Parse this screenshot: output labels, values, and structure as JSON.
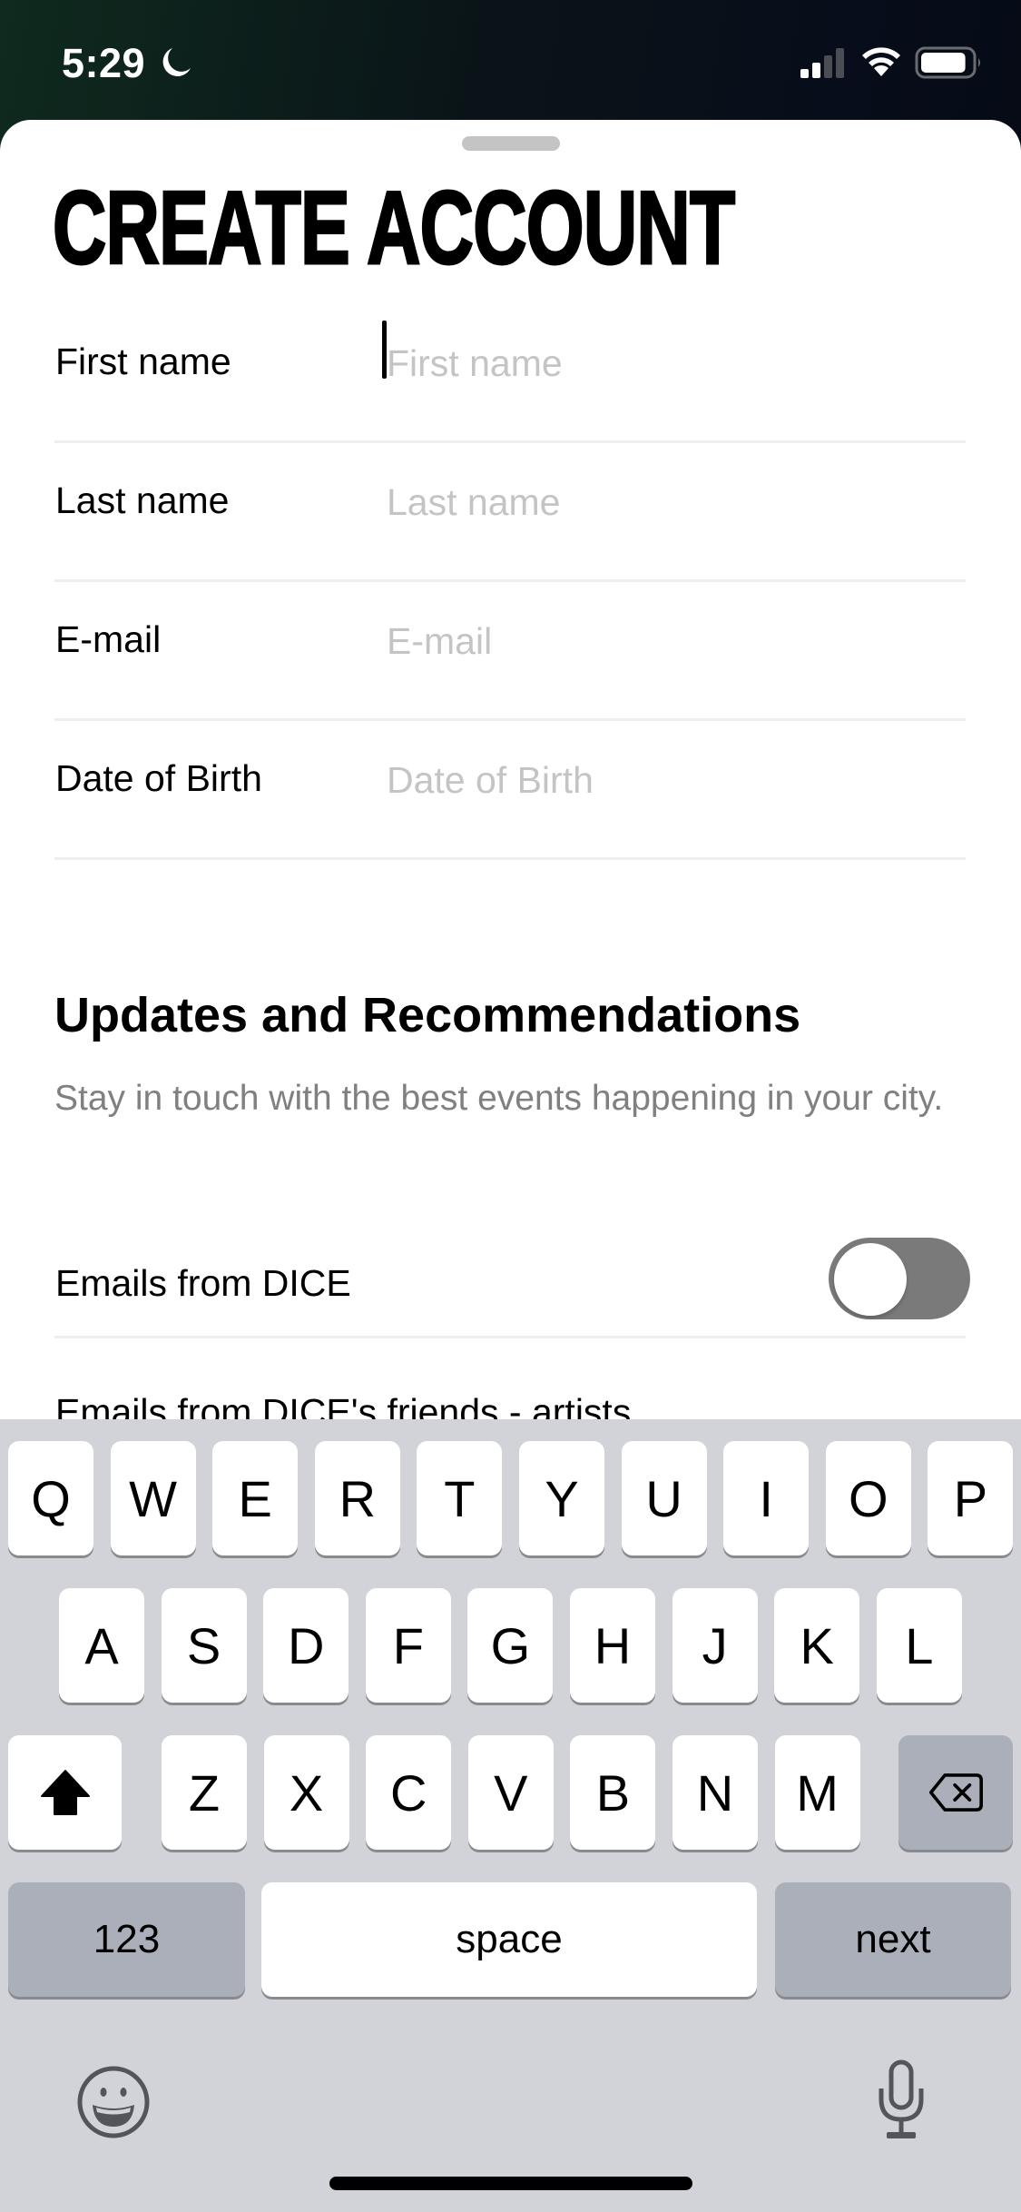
{
  "status_bar": {
    "time": "5:29",
    "focus_icon": "moon-icon",
    "signal_bars_filled": 2,
    "signal_bars_total": 4,
    "wifi_icon": "wifi-icon",
    "battery_level": 0.9
  },
  "sheet": {
    "title": "CREATE ACCOUNT",
    "fields": [
      {
        "label": "First name",
        "placeholder": "First name",
        "value": "",
        "focused": true
      },
      {
        "label": "Last name",
        "placeholder": "Last name",
        "value": ""
      },
      {
        "label": "E-mail",
        "placeholder": "E-mail",
        "value": ""
      },
      {
        "label": "Date of Birth",
        "placeholder": "Date of Birth",
        "value": ""
      }
    ],
    "updates": {
      "heading": "Updates and Recommendations",
      "description": "Stay in touch with the best events happening in your city.",
      "toggles": [
        {
          "label": "Emails from DICE",
          "on": false
        },
        {
          "label": "Emails from DICE's friends -  artists,",
          "on": false
        }
      ]
    }
  },
  "keyboard": {
    "row1": [
      "Q",
      "W",
      "E",
      "R",
      "T",
      "Y",
      "U",
      "I",
      "O",
      "P"
    ],
    "row2": [
      "A",
      "S",
      "D",
      "F",
      "G",
      "H",
      "J",
      "K",
      "L"
    ],
    "row3": [
      "Z",
      "X",
      "C",
      "V",
      "B",
      "N",
      "M"
    ],
    "shift_icon": "shift-arrow-icon",
    "delete_icon": "delete-backspace-icon",
    "numbers_label": "123",
    "space_label": "space",
    "return_label": "next",
    "emoji_icon": "emoji-icon",
    "dictation_icon": "microphone-icon"
  },
  "colors": {
    "keyboard_bg": "#d1d3d9",
    "special_key": "#abafba",
    "toggle_off_track": "#7a7a7a",
    "placeholder": "#c4c4c4",
    "subtitle": "#808080"
  }
}
